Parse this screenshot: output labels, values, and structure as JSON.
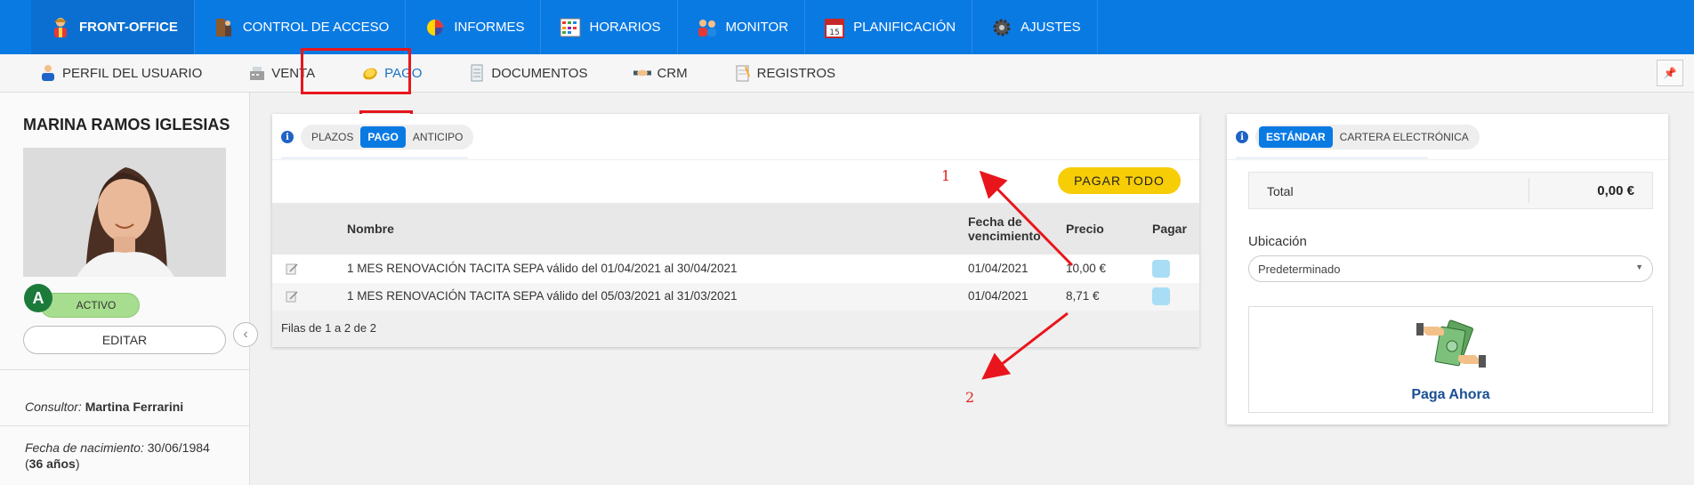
{
  "topnav": [
    {
      "label": "FRONT-OFFICE",
      "icon": "user-icon",
      "active": true
    },
    {
      "label": "CONTROL DE ACCESO",
      "icon": "door-icon"
    },
    {
      "label": "INFORMES",
      "icon": "pie-chart-icon"
    },
    {
      "label": "HORARIOS",
      "icon": "calendar-grid-icon"
    },
    {
      "label": "MONITOR",
      "icon": "people-icon"
    },
    {
      "label": "PLANIFICACIÓN",
      "icon": "calendar-icon"
    },
    {
      "label": "AJUSTES",
      "icon": "gear-icon"
    }
  ],
  "subnav": [
    {
      "label": "PERFIL DEL USUARIO",
      "icon": "user-profile-icon"
    },
    {
      "label": "VENTA",
      "icon": "cash-register-icon"
    },
    {
      "label": "PAGO",
      "icon": "coin-icon",
      "active": true
    },
    {
      "label": "DOCUMENTOS",
      "icon": "document-icon"
    },
    {
      "label": "CRM",
      "icon": "handshake-icon"
    },
    {
      "label": "REGISTROS",
      "icon": "notepad-icon"
    }
  ],
  "pin_icon": "pin-icon",
  "profile": {
    "name": "MARINA RAMOS IGLESIAS",
    "avatar_letter": "A",
    "status": "ACTIVO",
    "edit_label": "EDITAR",
    "consultant_label": "Consultor:",
    "consultant_name": "Martina Ferrarini",
    "birth_label": "Fecha de nacimiento:",
    "birth_date": "30/06/1984",
    "age": "36 años"
  },
  "payments": {
    "tabs": [
      "PLAZOS",
      "PAGO",
      "ANTICIPO"
    ],
    "active_tab": "PAGO",
    "pay_all_label": "PAGAR TODO",
    "columns": {
      "name": "Nombre",
      "due": "Fecha de vencimiento",
      "due_line1": "Fecha de",
      "due_line2": "vencimiento",
      "price": "Precio",
      "pay": "Pagar"
    },
    "rows": [
      {
        "name": "1 MES RENOVACIÓN TACITA SEPA válido del 01/04/2021 al 30/04/2021",
        "due": "01/04/2021",
        "price": "10,00 €"
      },
      {
        "name": "1 MES RENOVACIÓN TACITA SEPA válido del 05/03/2021 al 31/03/2021",
        "due": "01/04/2021",
        "price": "8,71 €"
      }
    ],
    "footer": "Filas de 1 a 2 de 2"
  },
  "checkout": {
    "tabs": [
      "ESTÁNDAR",
      "CARTERA ELECTRÓNICA"
    ],
    "active_tab": "ESTÁNDAR",
    "total_label": "Total",
    "total_value": "0,00 €",
    "location_label": "Ubicación",
    "location_value": "Predeterminado",
    "pay_now_label": "Paga Ahora"
  },
  "annotations": [
    "1",
    "2"
  ],
  "colors": {
    "primary": "#0a7ae3",
    "pay_button": "#f7cd06",
    "active_status": "#a6dd8e",
    "annotation": "#e8161c"
  }
}
